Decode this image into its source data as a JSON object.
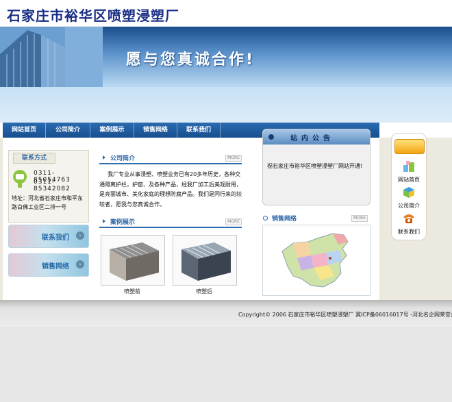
{
  "header": {
    "site_title": "石家庄市裕华区喷塑浸塑厂"
  },
  "banner": {
    "slogan": "愿与您真诚合作!"
  },
  "nav": {
    "items": [
      "网站首页",
      "公司简介",
      "案例展示",
      "销售网络",
      "联系我们"
    ]
  },
  "contact": {
    "title": "联系方式",
    "phone1": "0311-85054763",
    "phone2": "0311-85342082",
    "address": "地址：河北省石家庄市和平东路白佛工业区二排一号"
  },
  "side_buttons": {
    "contact_label": "联系我们",
    "sales_label": "销售网络"
  },
  "intro": {
    "title": "公司简介",
    "more": "MORE",
    "text": "我厂专业从事浸塑、喷塑业务已有20多年历史，各种交通隔离护栏，护窗、及各种产品，经我厂加工后美观耐用，是亮丽城市、美化家庭的理想防腐产品。我们是同行来的较较者，愿我与您真诚合作。"
  },
  "cases": {
    "title": "案例展示",
    "more": "MORE",
    "items": [
      {
        "caption": "喷塑前"
      },
      {
        "caption": "喷塑后"
      }
    ]
  },
  "notice": {
    "title": "站内公告",
    "text": "祝石家庄市裕华区喷塑浸塑厂网站开通!"
  },
  "sales": {
    "title": "销售网络",
    "more": "MORE"
  },
  "right_bar": {
    "items": [
      "网站首页",
      "公司简介",
      "联系我们"
    ]
  },
  "footer": {
    "copyright": "Copyright© 2006 石家庄市裕华区喷塑浸塑厂  冀ICP备06016017号  -河北名企网荣誉企业"
  }
}
